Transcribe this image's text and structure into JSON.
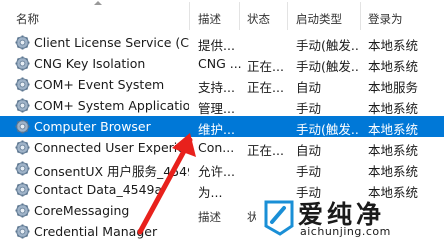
{
  "columns": [
    "名称",
    "描述",
    "状态",
    "启动类型",
    "登录为"
  ],
  "rows": [
    {
      "name": "Client License Service (Cli...",
      "desc": "提供...",
      "status": "",
      "start": "手动(触发...",
      "logon": "本地系统",
      "selected": false
    },
    {
      "name": "CNG Key Isolation",
      "desc": "CNG ...",
      "status": "正在...",
      "start": "手动(触发...",
      "logon": "本地系统",
      "selected": false
    },
    {
      "name": "COM+ Event System",
      "desc": "支持...",
      "status": "正在...",
      "start": "自动",
      "logon": "本地服务",
      "selected": false
    },
    {
      "name": "COM+ System Application",
      "desc": "管理...",
      "status": "",
      "start": "手动",
      "logon": "本地系统",
      "selected": false
    },
    {
      "name": "Computer Browser",
      "desc": "维护...",
      "status": "",
      "start": "手动(触发...",
      "logon": "本地系统",
      "selected": true
    },
    {
      "name": "Connected User Experien...",
      "desc": "Con...",
      "status": "正在...",
      "start": "自动",
      "logon": "本地系统",
      "selected": false
    },
    {
      "name": "ConsentUX 用户服务_4549a",
      "desc": "允许...",
      "status": "",
      "start": "手动",
      "logon": "本地系统",
      "selected": false
    },
    {
      "name": "Contact Data_4549a",
      "desc": "为...",
      "status": "",
      "start": "手动",
      "logon": "本地系统",
      "selected": false
    },
    {
      "name": "CoreMessaging",
      "desc": "",
      "status": "",
      "start": "",
      "logon": "",
      "selected": false
    },
    {
      "name": "Credential Manager",
      "desc": "",
      "status": "",
      "start": "",
      "logon": "",
      "selected": false
    }
  ],
  "overlay_headers": [
    "描述",
    "状态"
  ],
  "watermark": {
    "text": "爱纯净",
    "url": "aichunjing.com"
  }
}
